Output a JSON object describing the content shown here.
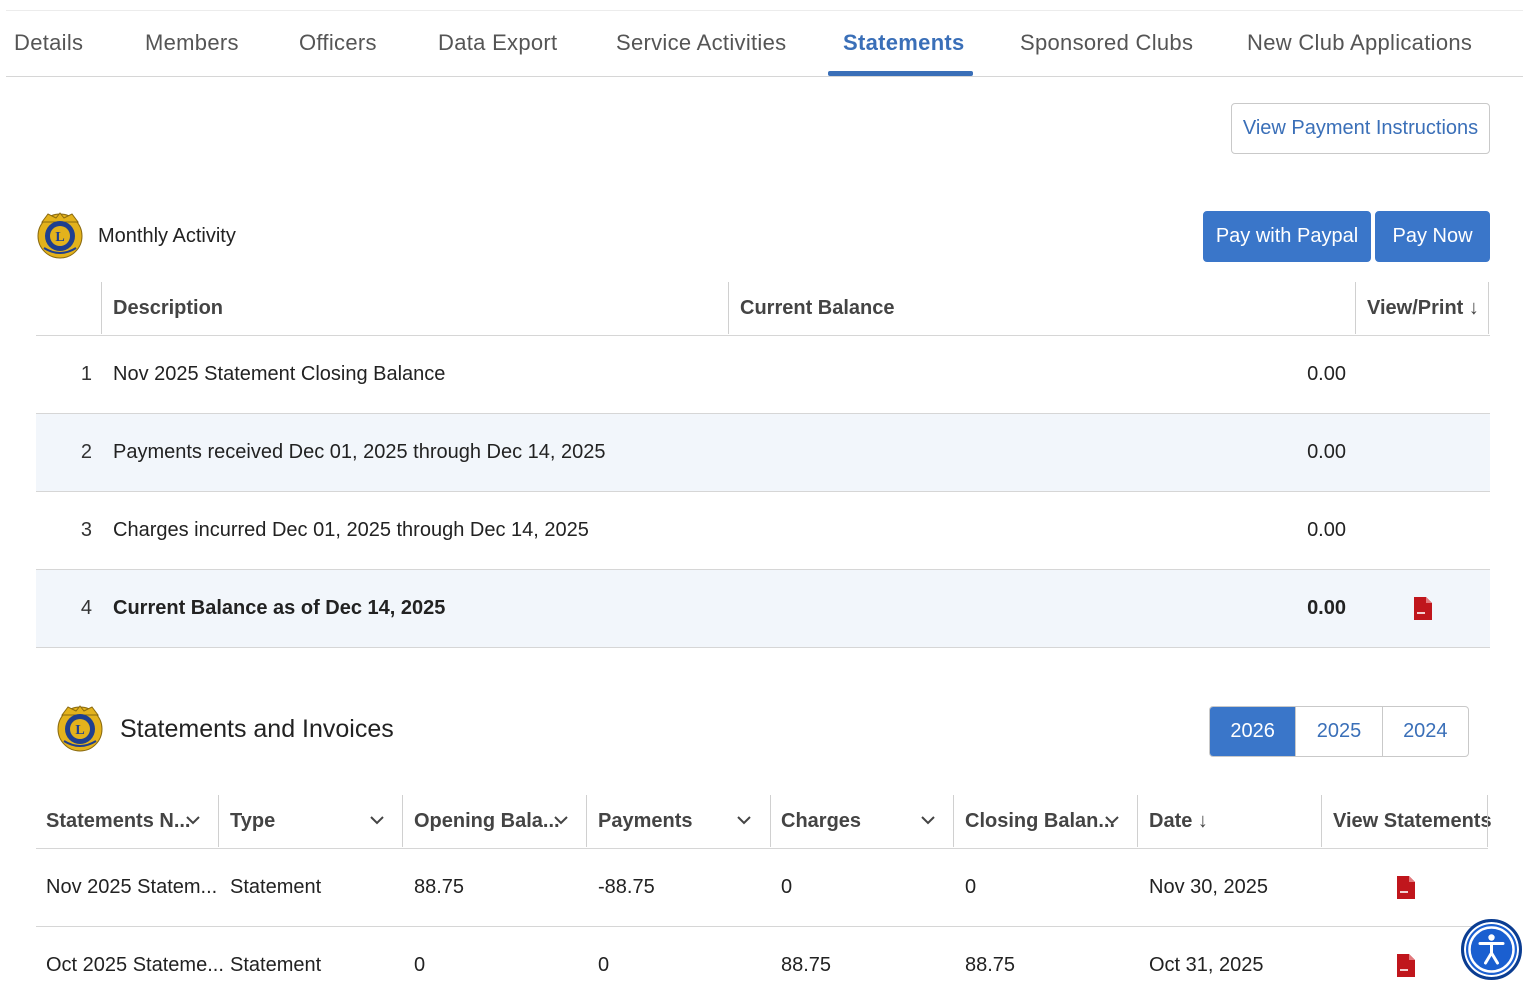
{
  "tabs": [
    {
      "label": "Details"
    },
    {
      "label": "Members"
    },
    {
      "label": "Officers"
    },
    {
      "label": "Data Export"
    },
    {
      "label": "Service Activities"
    },
    {
      "label": "Statements"
    },
    {
      "label": "Sponsored Clubs"
    },
    {
      "label": "New Club Applications"
    }
  ],
  "active_tab": "Statements",
  "buttons": {
    "payment_instructions": "View Payment Instructions",
    "pay_paypal": "Pay with Paypal",
    "pay_now": "Pay Now"
  },
  "monthly": {
    "title": "Monthly Activity",
    "columns": {
      "description": "Description",
      "balance": "Current Balance",
      "view": "View/Print ↓"
    },
    "rows": [
      {
        "num": "1",
        "description": "Nov 2025 Statement Closing Balance",
        "balance": "0.00"
      },
      {
        "num": "2",
        "description": "Payments received Dec 01, 2025 through Dec 14, 2025",
        "balance": "0.00"
      },
      {
        "num": "3",
        "description": "Charges incurred Dec 01, 2025 through Dec 14, 2025",
        "balance": "0.00"
      },
      {
        "num": "4",
        "description": "Current Balance as of Dec 14, 2025",
        "balance": "0.00"
      }
    ]
  },
  "statements": {
    "title": "Statements and Invoices",
    "years": [
      "2026",
      "2025",
      "2024"
    ],
    "active_year": "2026",
    "columns": {
      "name": "Statements N...",
      "type": "Type",
      "opening": "Opening Bala...",
      "payments": "Payments",
      "charges": "Charges",
      "closing": "Closing Balan...",
      "date": "Date ↓",
      "view": "View Statements"
    },
    "rows": [
      {
        "name": "Nov 2025 Statem...",
        "type": "Statement",
        "opening": "88.75",
        "payments": "-88.75",
        "charges": "0",
        "closing": "0",
        "date": "Nov 30, 2025"
      },
      {
        "name": "Oct 2025 Stateme...",
        "type": "Statement",
        "opening": "0",
        "payments": "0",
        "charges": "88.75",
        "closing": "88.75",
        "date": "Oct 31, 2025"
      }
    ]
  },
  "icons": {
    "pdf": "pdf-file-icon",
    "logo": "lions-logo-icon",
    "chevron": "chevron-down-icon",
    "accessibility": "accessibility-icon"
  },
  "colors": {
    "accent": "#3a6fb8",
    "primary_button": "#3a76c9",
    "row_alt": "#f2f6fb",
    "pdf_red": "#c0161c",
    "logo_gold": "#e3b21c",
    "logo_blue": "#1f3f8f"
  }
}
